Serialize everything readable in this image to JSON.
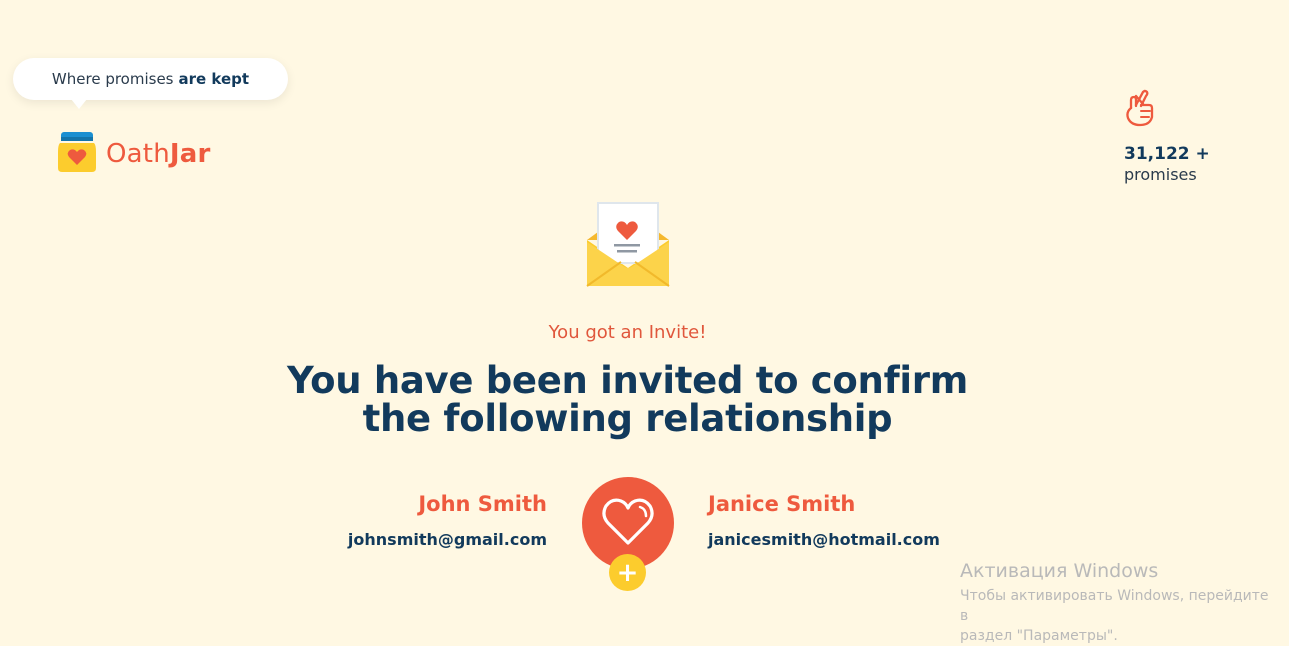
{
  "header": {
    "tagline_prefix": "Where promises",
    "tagline_bold": "are kept",
    "logo_prefix": "Oath",
    "logo_bold": "Jar"
  },
  "stats": {
    "icon": "crossed-fingers-icon",
    "count": "31,122 +",
    "label": "promises"
  },
  "invite": {
    "envelope_icon": "envelope-heart-icon",
    "subtitle": "You got an Invite!",
    "headline_line1": "You have been invited to confirm",
    "headline_line2": "the following relationship"
  },
  "relationship": {
    "left": {
      "name": "John Smith",
      "email": "johnsmith@gmail.com"
    },
    "right": {
      "name": "Janice Smith",
      "email": "janicesmith@hotmail.com"
    },
    "heart_icon": "heart-icon",
    "plus_label": "+"
  },
  "watermark": {
    "title": "Активация Windows",
    "text_line1": "Чтобы активировать Windows, перейдите в",
    "text_line2": "раздел \"Параметры\"."
  },
  "colors": {
    "background": "#fff8e3",
    "accent": "#ee5a3e",
    "navy": "#123a5c",
    "yellow": "#fccc2d"
  }
}
